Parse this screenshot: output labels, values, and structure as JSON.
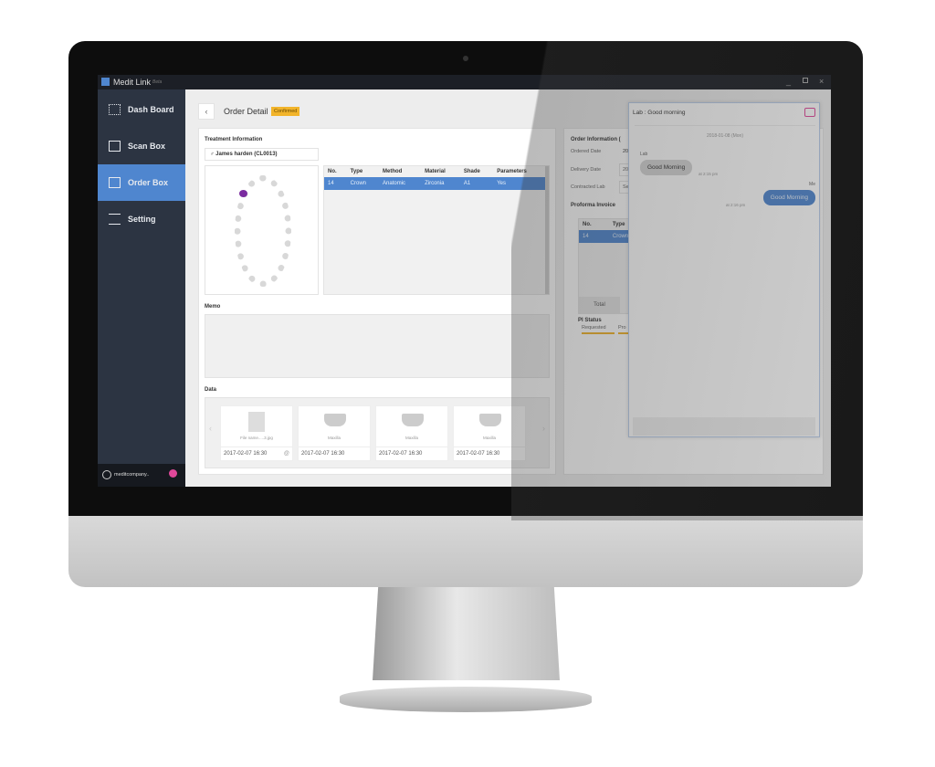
{
  "app": {
    "title": "Medit Link",
    "edition": "Beta",
    "window_controls": [
      "minimize",
      "maximize",
      "close"
    ]
  },
  "sidebar": {
    "items": [
      {
        "label": "Dash Board",
        "icon": "grid-icon"
      },
      {
        "label": "Scan Box",
        "icon": "scan-icon"
      },
      {
        "label": "Order Box",
        "icon": "order-icon",
        "active": true
      },
      {
        "label": "Setting",
        "icon": "sliders-icon"
      }
    ],
    "user": "meditcompany..",
    "notification_icon": "bell-icon"
  },
  "header": {
    "title": "Order Detail",
    "status": "Confirmed",
    "status_color": "#f2b42a"
  },
  "treatment": {
    "title": "Treatment Information",
    "patient": "James harden (CL0013)",
    "columns": [
      "No.",
      "Type",
      "Method",
      "Material",
      "Shade",
      "Parameters"
    ],
    "rows": [
      [
        "14",
        "Crown",
        "Anatomic",
        "Zirconia",
        "A1",
        "Yes"
      ]
    ]
  },
  "memo": {
    "title": "Memo",
    "value": ""
  },
  "data": {
    "title": "Data",
    "items": [
      {
        "name": "File name.....3.jpg",
        "date": "2017-02-07 16:30",
        "type": "file"
      },
      {
        "name": "Maxilla",
        "date": "2017-02-07 16:30"
      },
      {
        "name": "Maxilla",
        "date": "2017-02-07 16:30"
      },
      {
        "name": "Maxilla",
        "date": "2017-02-07 16:30"
      }
    ]
  },
  "order_info": {
    "title": "Order Information (",
    "fields": [
      {
        "label": "Ordered Date",
        "value": "20"
      },
      {
        "label": "Delivery Date",
        "value": "20"
      },
      {
        "label": "Contracted Lab",
        "value": "Se"
      }
    ]
  },
  "proforma": {
    "title": "Proforma Invoice",
    "columns": [
      "No.",
      "Type"
    ],
    "rows": [
      [
        "14",
        "Crown"
      ]
    ],
    "total_label": "Total",
    "status_title": "PI Status",
    "steps": [
      "Requested",
      "Pro"
    ]
  },
  "chat": {
    "title": "Lab : Good morning",
    "date": "2018-01-08 (Mon)",
    "messages": [
      {
        "sender": "Lab",
        "text": "Good Morning",
        "time": "at 2:15 pm"
      },
      {
        "sender": "Me",
        "text": "Good Morning",
        "time": "at 2:16 pm"
      }
    ],
    "accent": "#4f86cf"
  }
}
